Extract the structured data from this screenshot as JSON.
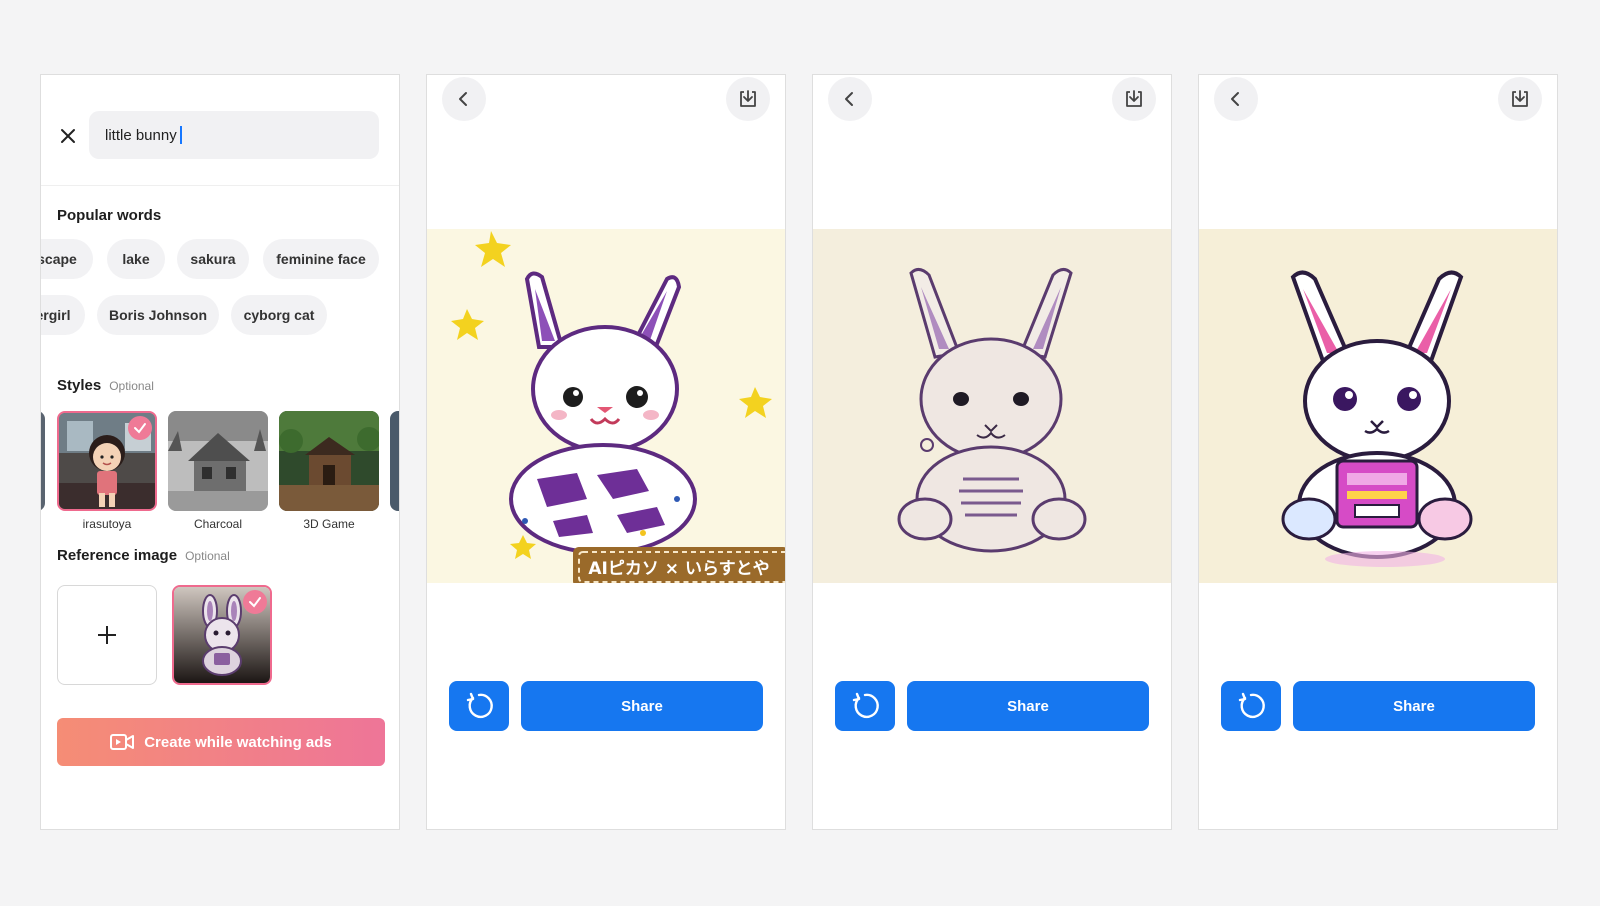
{
  "search": {
    "value": "little bunny"
  },
  "popular": {
    "title": "Popular words",
    "row1": [
      "scape",
      "lake",
      "sakura",
      "feminine face"
    ],
    "row2": [
      "ergirl",
      "Boris Johnson",
      "cyborg cat"
    ]
  },
  "styles": {
    "title": "Styles",
    "optional": "Optional",
    "items": [
      {
        "label": "irasutoya",
        "selected": true
      },
      {
        "label": "Charcoal",
        "selected": false
      },
      {
        "label": "3D Game",
        "selected": false
      }
    ]
  },
  "reference": {
    "title": "Reference image",
    "optional": "Optional",
    "add_symbol": "+"
  },
  "create_button": {
    "label": "Create while watching ads"
  },
  "results": [
    {
      "share_label": "Share",
      "watermark": "AIピカソ × いらすとや"
    },
    {
      "share_label": "Share"
    },
    {
      "share_label": "Share"
    }
  ],
  "colors": {
    "accent_blue": "#1677f0",
    "gradient_start": "#f58d75",
    "gradient_end": "#ee7598",
    "selected_border": "#ef6a8e",
    "page_bg": "#f4f4f5"
  },
  "icons": {
    "close": "close-icon",
    "back": "chevron-left-icon",
    "download": "download-icon",
    "regenerate": "refresh-icon",
    "video": "video-icon",
    "check": "check-icon",
    "plus": "plus-icon"
  }
}
